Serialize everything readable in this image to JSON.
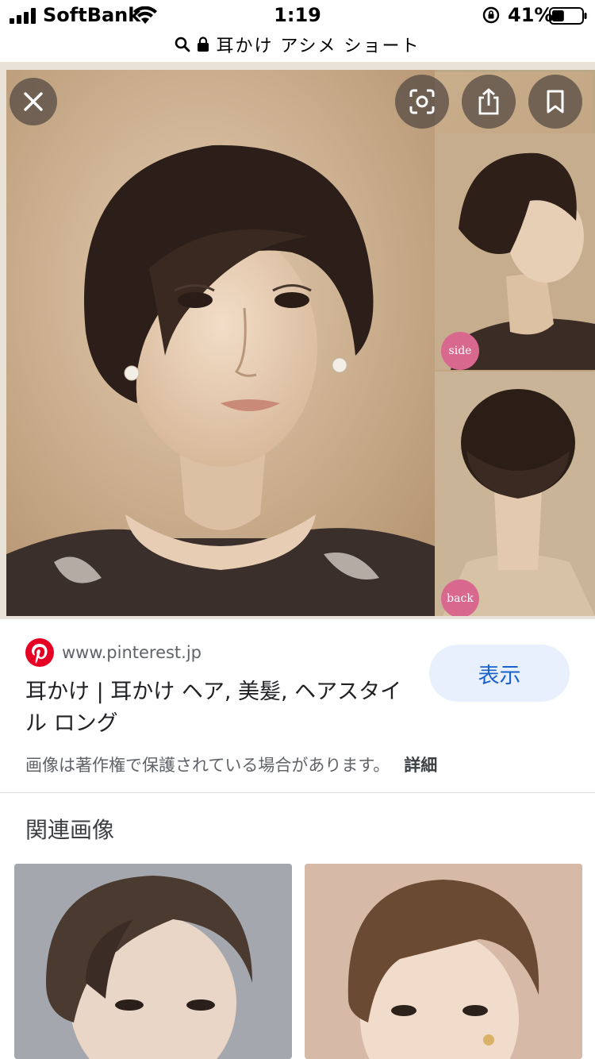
{
  "status_bar": {
    "carrier": "SoftBank",
    "time": "1:19",
    "battery_percent": "41%",
    "battery_level": 0.41,
    "icons": [
      "signal-icon",
      "wifi-icon",
      "rotation-lock-icon",
      "battery-icon"
    ]
  },
  "url_bar": {
    "query": "耳かけ アシメ ショート",
    "icons": [
      "search-icon",
      "lock-icon"
    ]
  },
  "image_viewer": {
    "side_label": "side",
    "back_label": "back",
    "buttons": [
      "close-icon",
      "lens-icon",
      "share-icon",
      "bookmark-icon"
    ]
  },
  "result": {
    "domain": "www.pinterest.jp",
    "title": "耳かけ | 耳かけ ヘア, 美髪, ヘアスタイル ロング",
    "view_button": "表示",
    "copyright_notice": "画像は著作権で保護されている場合があります。",
    "details_link": "詳細"
  },
  "related": {
    "heading": "関連画像"
  },
  "colors": {
    "pinterest_red": "#e60023",
    "view_button_bg": "#e8f0fe",
    "view_button_text": "#1a62c9",
    "label_pink": "#d8688e"
  }
}
